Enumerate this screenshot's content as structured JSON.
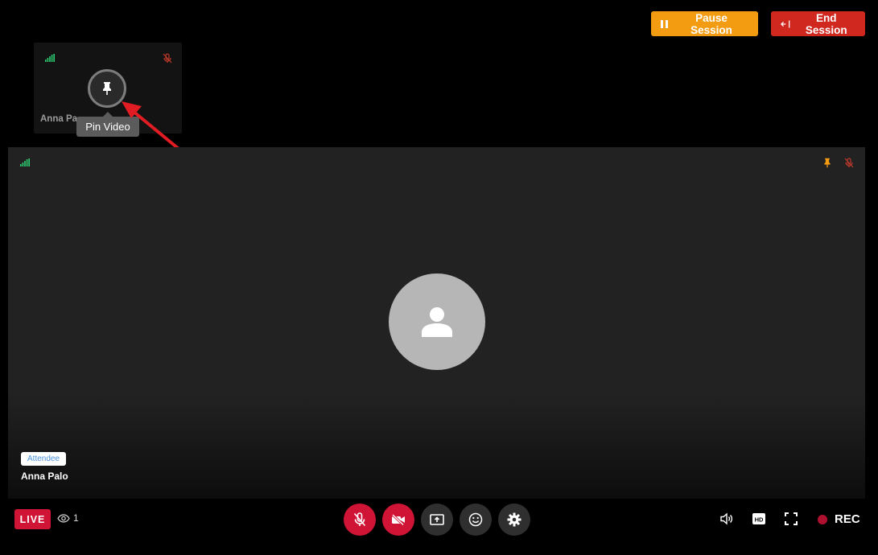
{
  "header": {
    "pause_label": "Pause Session",
    "end_label": "End Session"
  },
  "thumbnail": {
    "participant_name": "Anna Pa",
    "tooltip": "Pin Video"
  },
  "main_video": {
    "role_badge": "Attendee",
    "participant_name": "Anna Palo"
  },
  "footer": {
    "live_label": "LIVE",
    "viewer_count": "1",
    "rec_label": "REC"
  },
  "icons": [
    "signal-icon",
    "mic-off-icon",
    "pin-icon",
    "avatar-person-icon",
    "eye-icon",
    "mic-off-icon",
    "camera-off-icon",
    "screen-share-icon",
    "emoji-icon",
    "gear-icon",
    "volume-icon",
    "hd-icon",
    "fullscreen-icon",
    "record-dot-icon",
    "pause-icon",
    "exit-icon"
  ],
  "colors": {
    "pause": "#f39c12",
    "end": "#d0281f",
    "live": "#d01436",
    "signal": "#2ecc71",
    "pin_active": "#f39c12",
    "badge_text": "#4a90d9"
  }
}
